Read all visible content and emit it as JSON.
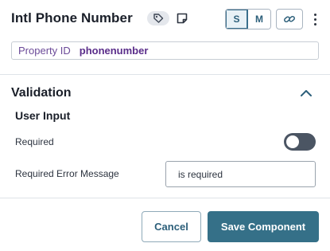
{
  "header": {
    "title": "Intl Phone Number",
    "icons": [
      "tag-icon",
      "note-icon",
      "link-icon",
      "more-vertical-icon"
    ],
    "size_options": [
      "S",
      "M"
    ],
    "selected_size": "S"
  },
  "property": {
    "label": "Property ID",
    "value": "phonenumber"
  },
  "validation": {
    "title": "Validation",
    "expanded": true,
    "subsection_title": "User Input",
    "required_label": "Required",
    "required_enabled": false,
    "error_message_label": "Required Error Message",
    "error_message_value": "is required"
  },
  "footer": {
    "cancel_label": "Cancel",
    "save_label": "Save Component"
  },
  "colors": {
    "primary": "#357088",
    "accent_purple": "#5a2d8a",
    "toggle_off": "#4b5563"
  }
}
